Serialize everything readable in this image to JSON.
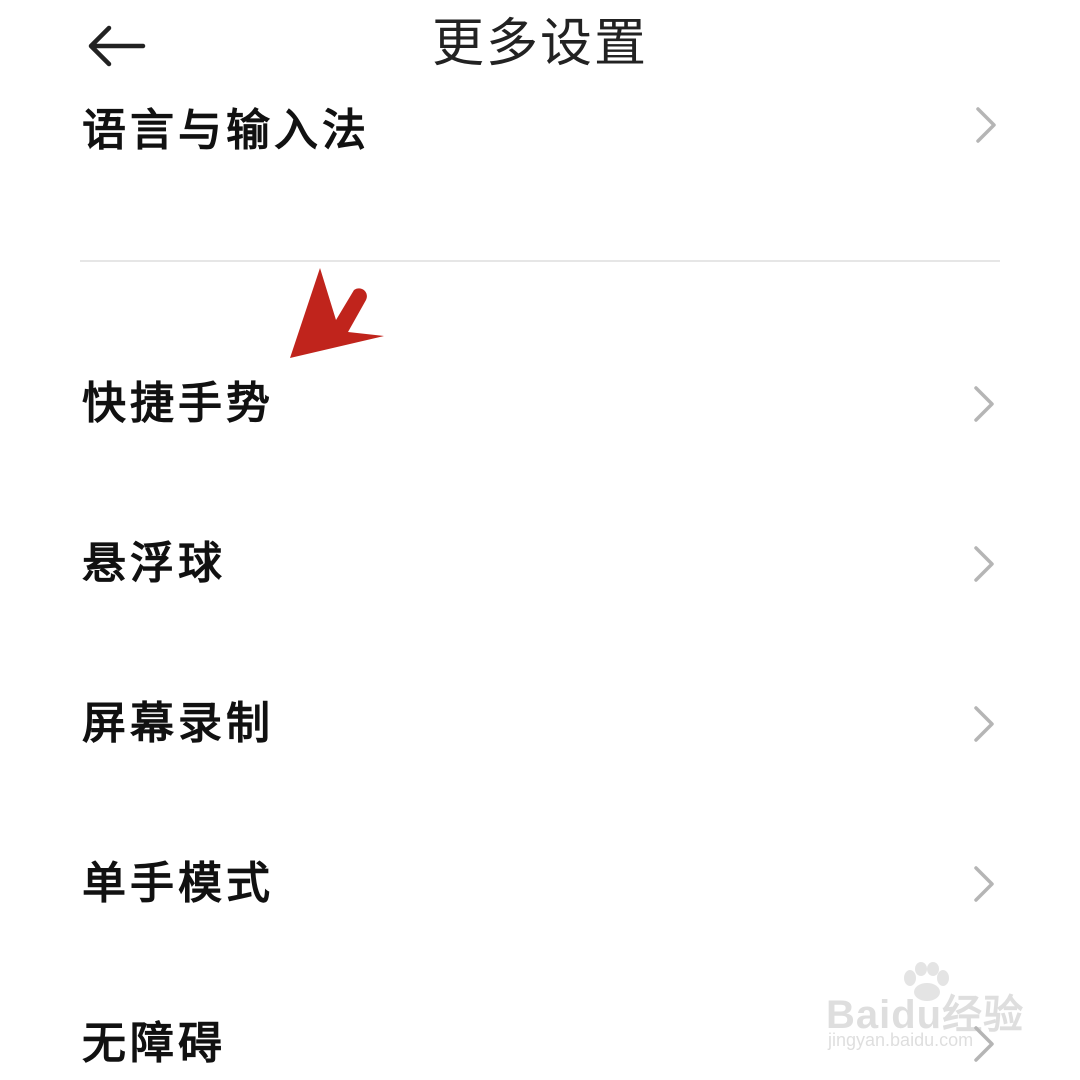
{
  "header": {
    "title": "更多设置",
    "back_icon": "arrow-left-icon"
  },
  "partial_item": {
    "label": "语言与输入法"
  },
  "settings": {
    "items": [
      {
        "label": "快捷手势"
      },
      {
        "label": "悬浮球"
      },
      {
        "label": "屏幕录制"
      },
      {
        "label": "单手模式"
      },
      {
        "label": "无障碍"
      }
    ]
  },
  "annotation": {
    "icon": "red-arrow-icon",
    "color": "#c0241c"
  },
  "watermark": {
    "brand": "Baidu经验",
    "url": "jingyan.baidu.com"
  },
  "colors": {
    "text": "#111111",
    "title": "#222222",
    "chevron": "#b5b5b5",
    "divider": "#e6e6e6"
  }
}
